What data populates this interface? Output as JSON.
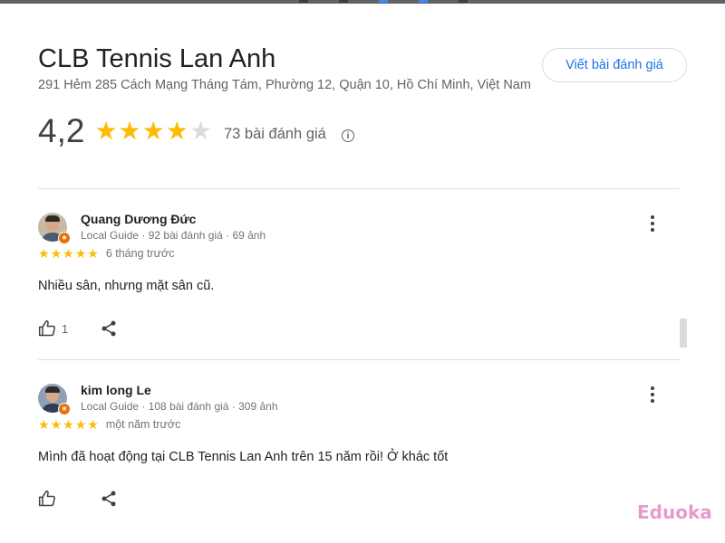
{
  "place": {
    "name": "CLB Tennis Lan Anh",
    "address": "291 Hẻm 285 Cách Mạng Tháng Tám, Phường 12, Quận 10, Hồ Chí Minh, Việt Nam",
    "write_review_label": "Viết bài đánh giá"
  },
  "rating": {
    "value": "4,2",
    "stars_filled": 4,
    "stars_total": 5,
    "review_count": "73 bài đánh giá",
    "info_icon": "info-icon"
  },
  "reviews": [
    {
      "author": "Quang Dương Đức",
      "meta": "Local Guide · 92 bài đánh giá · 69 ảnh",
      "stars": 5,
      "time": "6 tháng trước",
      "text": "Nhiều sân, nhưng mặt sân cũ.",
      "likes": "1"
    },
    {
      "author": "kim long Le",
      "meta": "Local Guide · 108 bài đánh giá · 309 ảnh",
      "stars": 5,
      "time": "một năm trước",
      "text": "Mình đã hoạt động tại CLB Tennis Lan Anh trên 15 năm rồi! Ở khác tốt",
      "likes": ""
    }
  ],
  "watermark": "Eduoka",
  "colors": {
    "star_on": "#fbbc04",
    "star_off": "#dadce0",
    "link_blue": "#1a73e8",
    "local_guide_badge": "#e8710a"
  }
}
